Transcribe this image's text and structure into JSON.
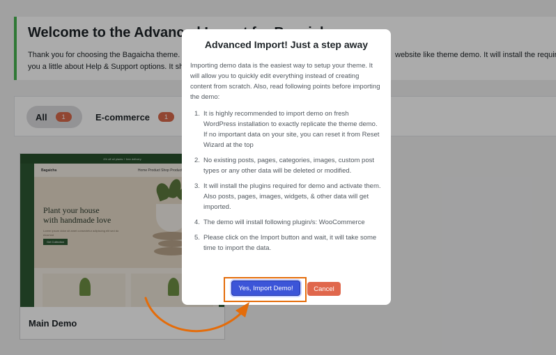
{
  "welcome": {
    "title": "Welcome to the Advanced Import for Bagaicha",
    "line1": "Thank you for choosing the Bagaicha theme. T",
    "line1_right": "website like theme demo. It will install the require",
    "line2": "you a little about Help & Support options. It sh"
  },
  "filters": [
    {
      "label": "All",
      "count": "1"
    },
    {
      "label": "E-commerce",
      "count": "1"
    }
  ],
  "demo": {
    "name": "Main Demo",
    "thumb": {
      "topbar": "4% off all plants + free delivery",
      "logo": "Bagaicha",
      "nav": "Home  Product  Shop  Product Pages  Pages  Blog",
      "hero_title_1": "Plant your house",
      "hero_title_2": "with handmade love",
      "hero_sub": "Lorem ipsum dolor sit amet consectetur adipiscing elit sed do eiusmod",
      "hero_button": "Get Collection"
    }
  },
  "modal": {
    "title": "Advanced Import! Just a step away",
    "intro": "Importing demo data is the easiest way to setup your theme. It will allow you to quickly edit everything instead of creating content from scratch. Also, read following points before importing the demo:",
    "points": [
      {
        "num": "1.",
        "text": "It is highly recommended to import demo on fresh WordPress installation to exactly replicate the theme demo. If no important data on your site, you can reset it from Reset Wizard at the top"
      },
      {
        "num": "2.",
        "text": "No existing posts, pages, categories, images, custom post types or any other data will be deleted or modified."
      },
      {
        "num": "3.",
        "text": "It will install the plugins required for demo and activate them. Also posts, pages, images, widgets, & other data will get imported."
      },
      {
        "num": "4.",
        "text": "The demo will install following plugin/s: WooCommerce"
      },
      {
        "num": "5.",
        "text": "Please click on the Import button and wait, it will take some time to import the data."
      }
    ],
    "import_label": "Yes, Import Demo!",
    "cancel_label": "Cancel"
  },
  "colors": {
    "accent_green": "#46b450",
    "badge": "#d9694b",
    "import_button": "#3c55d8",
    "cancel_button": "#e0674c",
    "annotation_orange": "#e46c0a"
  },
  "icons": {
    "annotation": "curved-arrow-icon"
  }
}
